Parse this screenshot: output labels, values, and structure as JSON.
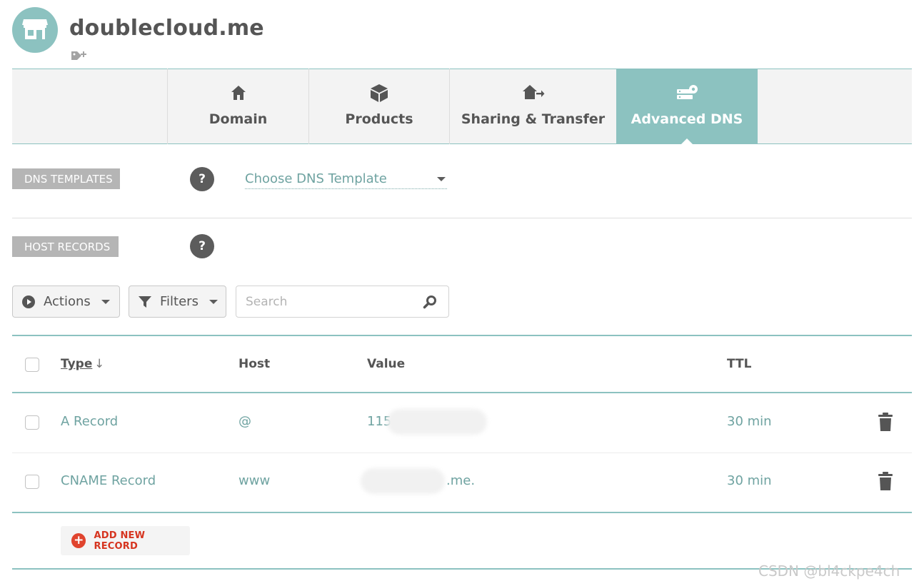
{
  "header": {
    "domain_name": "doublecloud.me",
    "logo_icon": "storefront-icon",
    "tag_icon": "tag-add-icon"
  },
  "tabs": [
    {
      "label": "Domain",
      "icon": "house-icon",
      "active": false
    },
    {
      "label": "Products",
      "icon": "box-icon",
      "active": false
    },
    {
      "label": "Sharing & Transfer",
      "icon": "house-transfer-icon",
      "active": false
    },
    {
      "label": "Advanced DNS",
      "icon": "server-settings-icon",
      "active": true
    }
  ],
  "dns_templates": {
    "label": "DNS TEMPLATES",
    "help": "?",
    "select_value": "Choose DNS Template"
  },
  "host_records": {
    "label": "HOST RECORDS",
    "help": "?"
  },
  "toolbar": {
    "actions_label": "Actions",
    "filters_label": "Filters",
    "search_placeholder": "Search"
  },
  "table": {
    "columns": {
      "type": "Type",
      "sort_indicator": "↓",
      "host": "Host",
      "value": "Value",
      "ttl": "TTL"
    },
    "rows": [
      {
        "type": "A Record",
        "host": "@",
        "value": "115",
        "ttl": "30 min"
      },
      {
        "type": "CNAME Record",
        "host": "www",
        "value": ".me.",
        "ttl": "30 min"
      }
    ]
  },
  "add_record_label": "ADD NEW RECORD",
  "watermark": "CSDN @bl4ckpe4ch",
  "colors": {
    "accent_teal": "#8cc2c0",
    "link_teal": "#6fa3a1",
    "danger_red": "#e0442e",
    "label_gray": "#b5b5b5"
  }
}
